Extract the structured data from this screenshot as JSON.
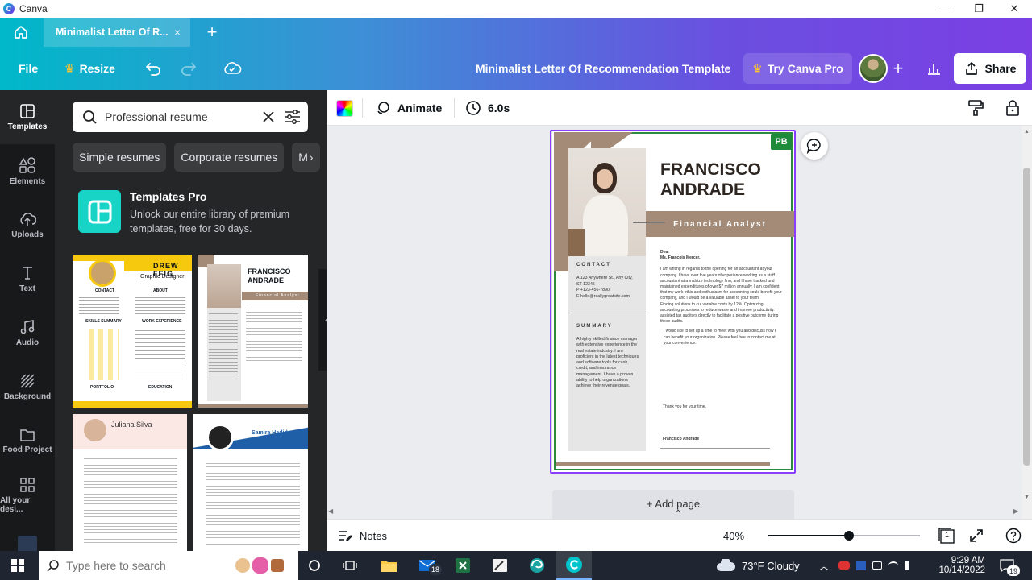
{
  "window": {
    "app_name": "Canva",
    "minimize": "—",
    "maximize": "❐",
    "close": "✕"
  },
  "tabs": {
    "active_tab": "Minimalist Letter Of R...",
    "close": "×",
    "new_tab": "+"
  },
  "toolbar": {
    "file": "File",
    "resize": "Resize",
    "doc_title": "Minimalist Letter Of Recommendation Template",
    "try_pro": "Try Canva Pro",
    "add_people": "+",
    "share": "Share"
  },
  "rail": [
    {
      "label": "Templates",
      "icon": "templates-icon"
    },
    {
      "label": "Elements",
      "icon": "elements-icon"
    },
    {
      "label": "Uploads",
      "icon": "uploads-icon"
    },
    {
      "label": "Text",
      "icon": "text-icon"
    },
    {
      "label": "Audio",
      "icon": "audio-icon"
    },
    {
      "label": "Background",
      "icon": "background-icon"
    },
    {
      "label": "Food Project",
      "icon": "folder-icon"
    },
    {
      "label": "All your desi...",
      "icon": "grid-icon"
    }
  ],
  "panel": {
    "search_value": "Professional resume",
    "chips": [
      "Simple resumes",
      "Corporate resumes",
      "M"
    ],
    "promo_title": "Templates Pro",
    "promo_desc": "Unlock our entire library of premium templates, free for 30 days.",
    "thumb1_name": "DREW FEIG",
    "thumb1_role": "Graphic Designer",
    "thumb1_sections": [
      "CONTACT",
      "ABOUT",
      "SKILLS SUMMARY",
      "WORK EXPERIENCE",
      "PORTFOLIO",
      "EDUCATION"
    ],
    "thumb2_name_1": "FRANCISCO",
    "thumb2_name_2": "ANDRADE",
    "thumb2_role": "Financial Analyst",
    "thumb3_name": "Juliana Silva",
    "thumb4_name": "Samira Hadid"
  },
  "canvas_toolbar": {
    "animate": "Animate",
    "duration": "6.0s"
  },
  "letter": {
    "name_line1": "FRANCISCO",
    "name_line2": "ANDRADE",
    "role": "Financial Analyst",
    "badge": "PB",
    "contact_heading": "CONTACT",
    "contact_lines": [
      "A  123 Anywhere St., Any City,",
      "    ST 12345",
      "P  +123-456-7890",
      "E  hello@reallygreatsite.com"
    ],
    "summary_heading": "SUMMARY",
    "summary_text": "A highly skilled finance manager with extensive experience in the real estate industry. I am proficient in the latest techniques and software tools for cash, credit, and insurance management. I have a proven ability to help organizations achieve their revenue goals.",
    "salutation_1": "Dear",
    "salutation_2": "Ms. Francois Mercer,",
    "para1": "I am writing in regards to the opening for an accountant at your company. I have over five years of experience working as a staff accountant at a midsize technology firm, and I have tracked and maintained expenditures of over $7 million annually. I am confident that my work ethic and enthusiasm for accounting could benefit your company, and I would be a valuable asset to your team.",
    "para2": "Finding solutions to cut variable costs by 12%. Optimizing accounting processes to reduce waste and improve productivity. I assisted tax auditors directly to facilitate a positive outcome during these audits.",
    "para3": "I would like to set up a time to meet with you and discuss how I can benefit your organization. Please feel free to contact me at your convenience.",
    "closing": "Thank you for your time,",
    "signature": "Francisco Andrade"
  },
  "add_page": "+ Add page",
  "footer": {
    "notes": "Notes",
    "zoom": "40%",
    "page_count": "1",
    "zoom_fraction": 0.53
  },
  "taskbar": {
    "search_placeholder": "Type here to search",
    "weather": "73°F  Cloudy",
    "time": "9:29 AM",
    "date": "10/14/2022",
    "mail_badge": "18",
    "notif_badge": "19"
  },
  "colors": {
    "accent_purple": "#8b3dff",
    "letter_brown": "#a38b78",
    "letter_gray": "#e6e6e6",
    "pb_green": "#1e8a3a"
  }
}
